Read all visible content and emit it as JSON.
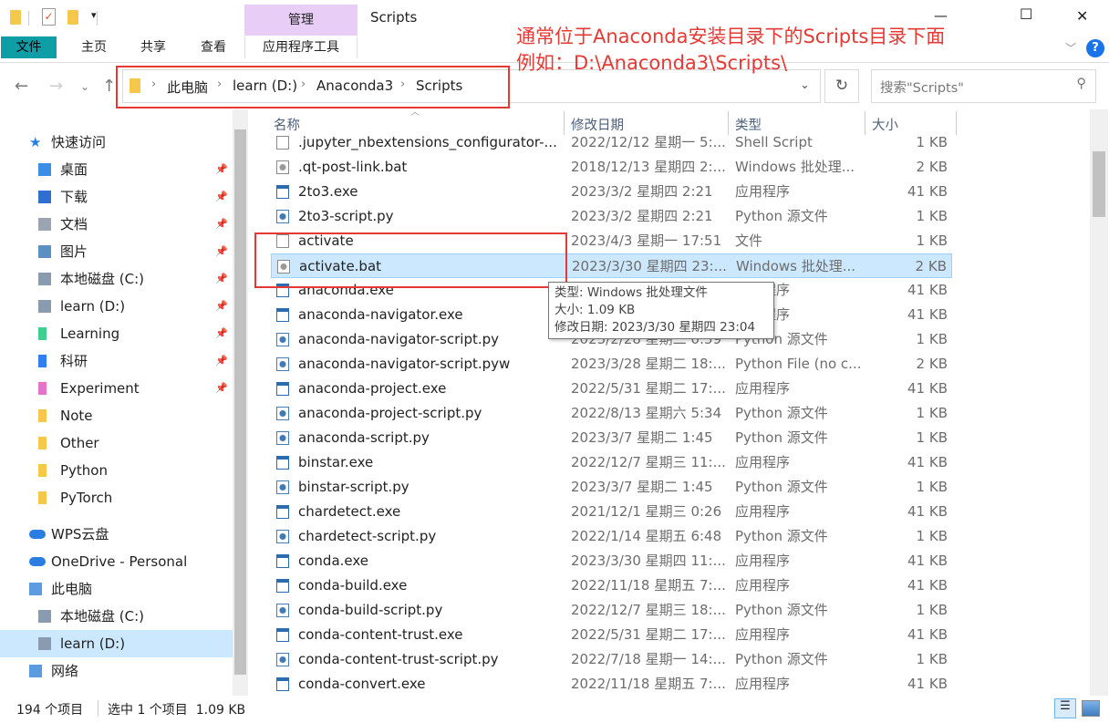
{
  "titlebar": {
    "title": "Scripts",
    "context_tab": "管理",
    "min": "—",
    "max": "☐",
    "close": "✕"
  },
  "ribbon": {
    "tabs": [
      "文件",
      "主页",
      "共享",
      "查看",
      "应用程序工具"
    ],
    "help": "?"
  },
  "address": {
    "crumbs": [
      "此电脑",
      "learn (D:)",
      "Anaconda3",
      "Scripts"
    ],
    "search_placeholder": "搜索\"Scripts\""
  },
  "annotation": {
    "line1": "通常位于Anaconda安装目录下的Scripts目录下面",
    "line2": "例如：D:\\Anaconda3\\Scripts\\",
    "color": "#e53935"
  },
  "sidebar": [
    {
      "label": "快速访问",
      "icon": "star-icon",
      "pin": false,
      "top": true
    },
    {
      "label": "桌面",
      "icon": "desktop-icon",
      "pin": true
    },
    {
      "label": "下载",
      "icon": "download-icon",
      "pin": true
    },
    {
      "label": "文档",
      "icon": "document-icon",
      "pin": true
    },
    {
      "label": "图片",
      "icon": "picture-icon",
      "pin": true
    },
    {
      "label": "本地磁盘 (C:)",
      "icon": "drive-icon",
      "pin": true
    },
    {
      "label": "learn (D:)",
      "icon": "drive-icon",
      "pin": true
    },
    {
      "label": "Learning",
      "icon": "folder-green-icon",
      "pin": true
    },
    {
      "label": "科研",
      "icon": "folder-blue-icon",
      "pin": true
    },
    {
      "label": "Experiment",
      "icon": "folder-pink-icon",
      "pin": true
    },
    {
      "label": "Note",
      "icon": "folder-icon",
      "pin": false
    },
    {
      "label": "Other",
      "icon": "folder-icon",
      "pin": false
    },
    {
      "label": "Python",
      "icon": "folder-icon",
      "pin": false
    },
    {
      "label": "PyTorch",
      "icon": "folder-icon",
      "pin": false
    },
    {
      "label": "WPS云盘",
      "icon": "cloud-icon",
      "pin": false,
      "top": true
    },
    {
      "label": "OneDrive - Personal",
      "icon": "cloud-icon",
      "pin": false,
      "top": true
    },
    {
      "label": "此电脑",
      "icon": "computer-icon",
      "pin": false,
      "top": true
    },
    {
      "label": "本地磁盘 (C:)",
      "icon": "drive-icon",
      "pin": false
    },
    {
      "label": "learn (D:)",
      "icon": "drive-icon",
      "pin": false,
      "selected": true
    },
    {
      "label": "网络",
      "icon": "network-icon",
      "pin": false,
      "top": true
    }
  ],
  "columns": [
    "名称",
    "修改日期",
    "类型",
    "大小"
  ],
  "files": [
    {
      "name": ".jupyter_nbextensions_configurator-...",
      "date": "2022/12/12 星期一 5:...",
      "type": "Shell Script",
      "size": "1 KB",
      "kind": "file"
    },
    {
      "name": ".qt-post-link.bat",
      "date": "2018/12/13 星期四 2:...",
      "type": "Windows 批处理...",
      "size": "2 KB",
      "kind": "bat"
    },
    {
      "name": "2to3.exe",
      "date": "2023/3/2 星期四 2:21",
      "type": "应用程序",
      "size": "41 KB",
      "kind": "exe"
    },
    {
      "name": "2to3-script.py",
      "date": "2023/3/2 星期四 2:21",
      "type": "Python 源文件",
      "size": "1 KB",
      "kind": "py"
    },
    {
      "name": "activate",
      "date": "2023/4/3 星期一 17:51",
      "type": "文件",
      "size": "1 KB",
      "kind": "file"
    },
    {
      "name": "activate.bat",
      "date": "2023/3/30 星期四 23:...",
      "type": "Windows 批处理...",
      "size": "2 KB",
      "kind": "bat",
      "selected": true
    },
    {
      "name": "anaconda.exe",
      "date": "",
      "type": "应用程序",
      "size": "41 KB",
      "kind": "exe"
    },
    {
      "name": "anaconda-navigator.exe",
      "date": "",
      "type": "应用程序",
      "size": "41 KB",
      "kind": "exe"
    },
    {
      "name": "anaconda-navigator-script.py",
      "date": "2023/2/28 星期二 0:59",
      "type": "Python 源文件",
      "size": "1 KB",
      "kind": "py"
    },
    {
      "name": "anaconda-navigator-script.pyw",
      "date": "2023/3/28 星期二 18:...",
      "type": "Python File (no c...",
      "size": "2 KB",
      "kind": "py"
    },
    {
      "name": "anaconda-project.exe",
      "date": "2022/5/31 星期二 17:...",
      "type": "应用程序",
      "size": "41 KB",
      "kind": "exe"
    },
    {
      "name": "anaconda-project-script.py",
      "date": "2022/8/13 星期六 5:34",
      "type": "Python 源文件",
      "size": "1 KB",
      "kind": "py"
    },
    {
      "name": "anaconda-script.py",
      "date": "2023/3/7 星期二 1:45",
      "type": "Python 源文件",
      "size": "1 KB",
      "kind": "py"
    },
    {
      "name": "binstar.exe",
      "date": "2022/12/7 星期三 11:...",
      "type": "应用程序",
      "size": "41 KB",
      "kind": "exe"
    },
    {
      "name": "binstar-script.py",
      "date": "2023/3/7 星期二 1:45",
      "type": "Python 源文件",
      "size": "1 KB",
      "kind": "py"
    },
    {
      "name": "chardetect.exe",
      "date": "2021/12/1 星期三 0:26",
      "type": "应用程序",
      "size": "41 KB",
      "kind": "exe"
    },
    {
      "name": "chardetect-script.py",
      "date": "2022/1/14 星期五 6:48",
      "type": "Python 源文件",
      "size": "1 KB",
      "kind": "py"
    },
    {
      "name": "conda.exe",
      "date": "2023/3/30 星期四 11:...",
      "type": "应用程序",
      "size": "41 KB",
      "kind": "exe"
    },
    {
      "name": "conda-build.exe",
      "date": "2022/11/18 星期五 7:...",
      "type": "应用程序",
      "size": "41 KB",
      "kind": "exe"
    },
    {
      "name": "conda-build-script.py",
      "date": "2022/12/7 星期三 18:...",
      "type": "Python 源文件",
      "size": "1 KB",
      "kind": "py"
    },
    {
      "name": "conda-content-trust.exe",
      "date": "2022/5/31 星期二 17:...",
      "type": "应用程序",
      "size": "41 KB",
      "kind": "exe"
    },
    {
      "name": "conda-content-trust-script.py",
      "date": "2022/7/18 星期一 14:...",
      "type": "Python 源文件",
      "size": "1 KB",
      "kind": "py"
    },
    {
      "name": "conda-convert.exe",
      "date": "2022/11/18 星期五 7:...",
      "type": "应用程序",
      "size": "41 KB",
      "kind": "exe"
    }
  ],
  "tooltip": {
    "type": "类型: Windows 批处理文件",
    "size": "大小: 1.09 KB",
    "date": "修改日期: 2023/3/30 星期四 23:04"
  },
  "status": {
    "count": "194 个项目",
    "selection": "选中 1 个项目  1.09 KB"
  }
}
